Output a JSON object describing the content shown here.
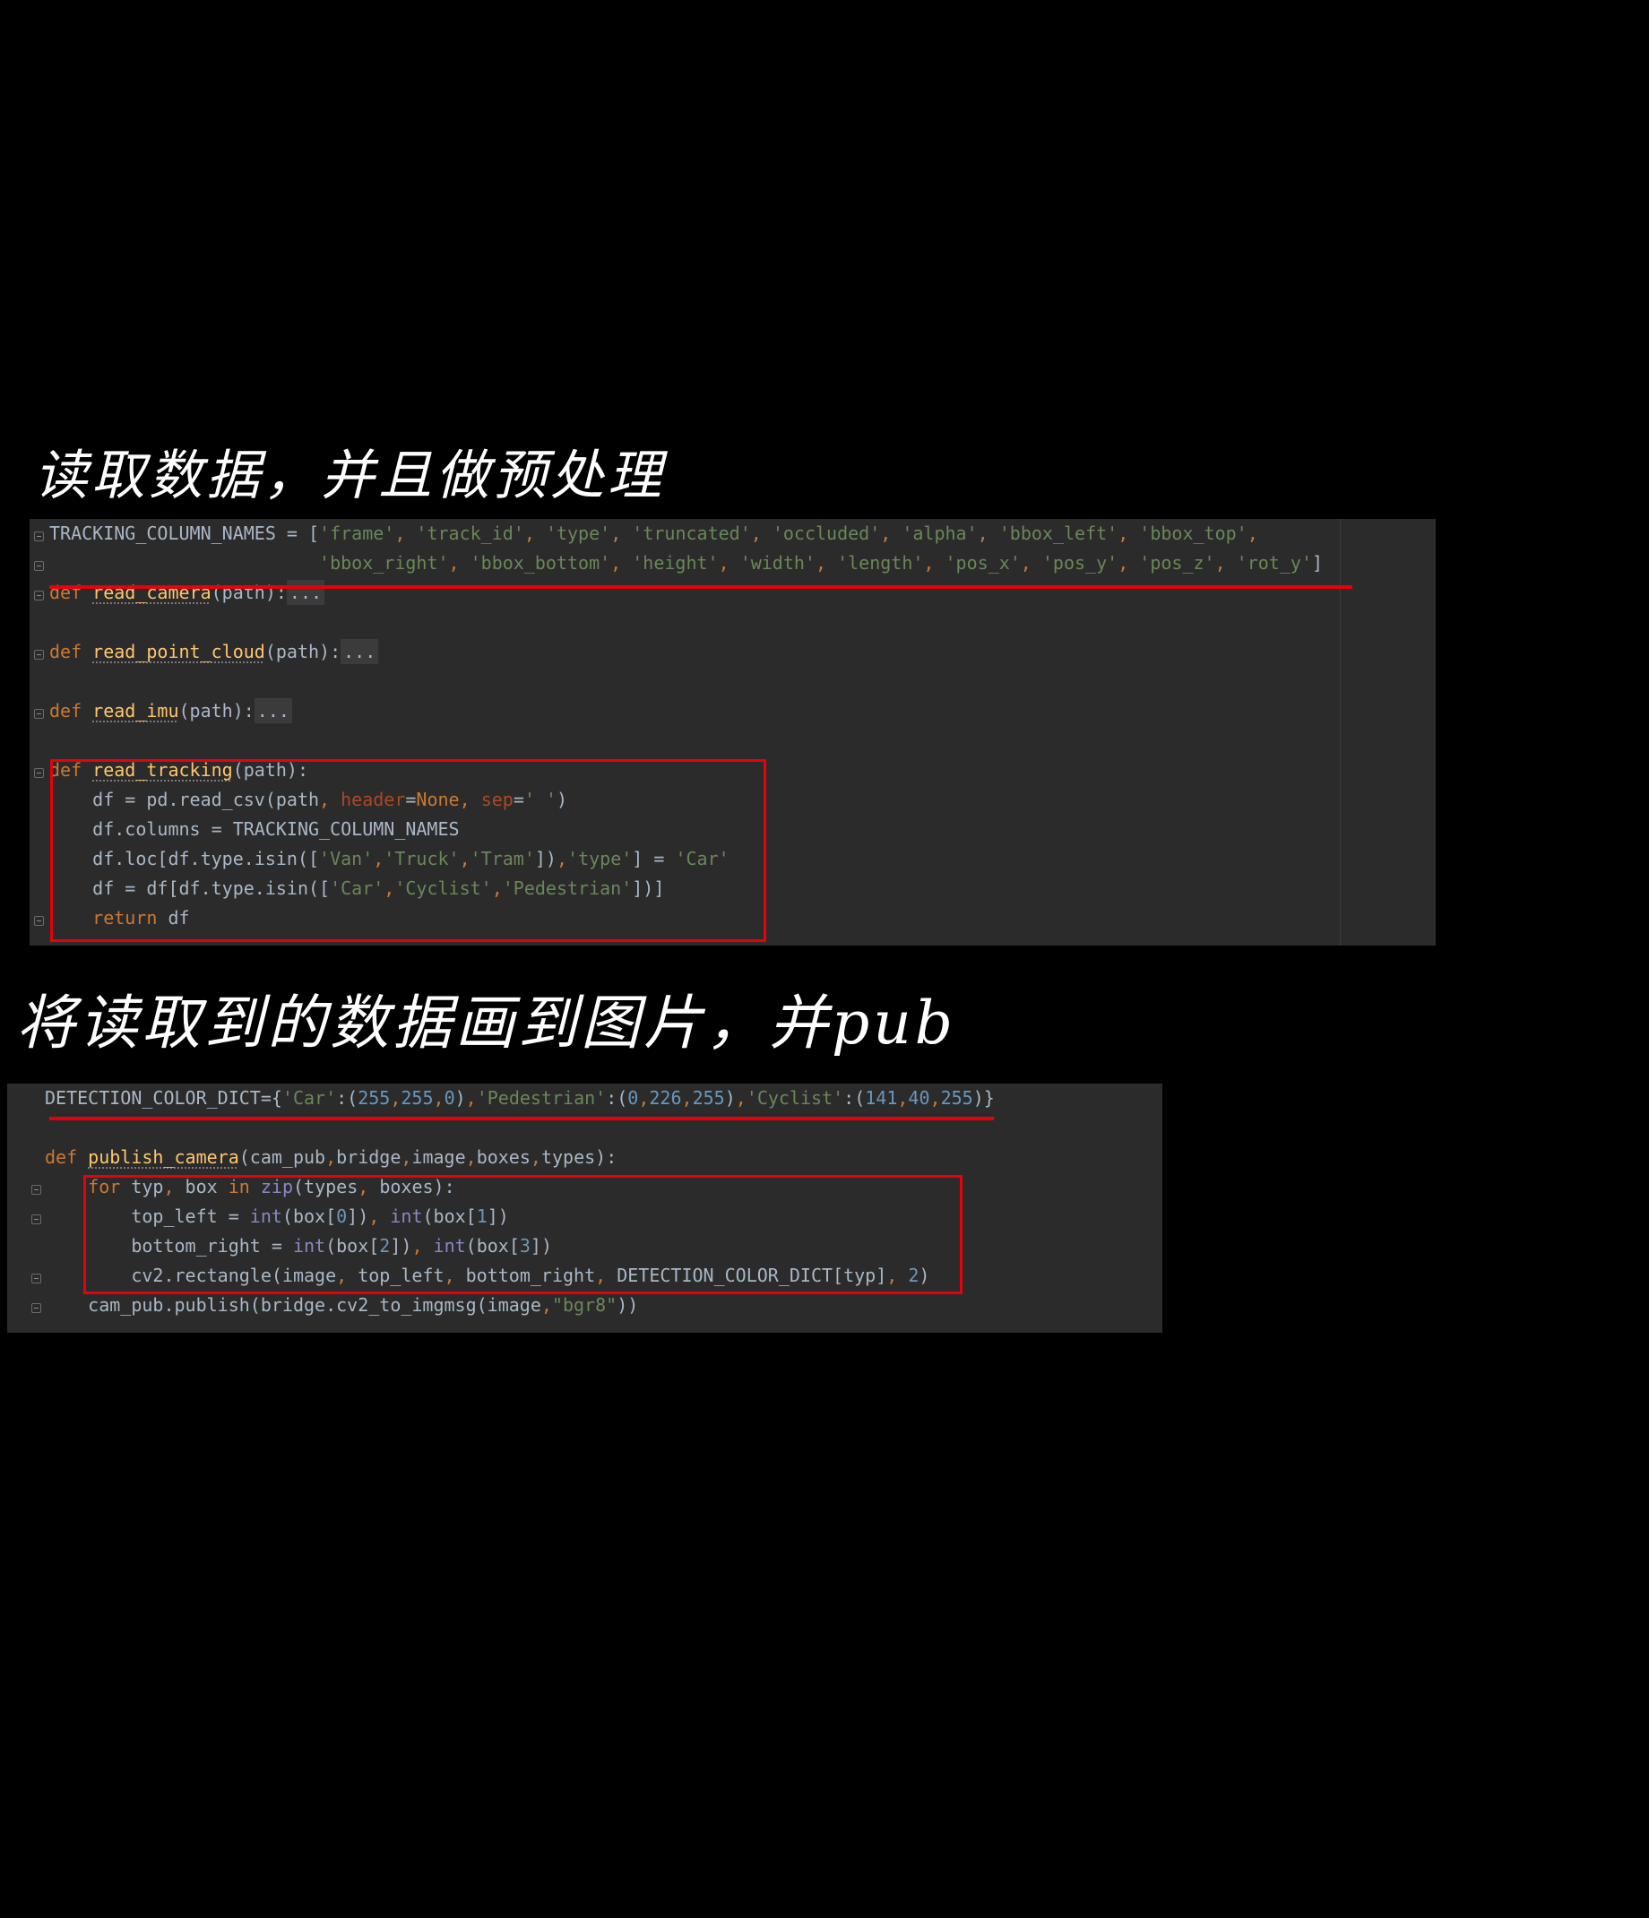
{
  "notes": {
    "section1": "读取数据，并且做预处理",
    "section2": "将读取到的数据画到图片，并pub"
  },
  "editor1": {
    "lines": [
      "TRACKING_COLUMN_NAMES = ['frame', 'track_id', 'type', 'truncated', 'occluded', 'alpha', 'bbox_left', 'bbox_top',",
      "                         'bbox_right', 'bbox_bottom', 'height', 'width', 'length', 'pos_x', 'pos_y', 'pos_z', 'rot_y']",
      "def read_camera(path):...",
      "",
      "def read_point_cloud(path):...",
      "",
      "def read_imu(path):...",
      "",
      "def read_tracking(path):",
      "    df = pd.read_csv(path, header=None, sep=' ')",
      "    df.columns = TRACKING_COLUMN_NAMES",
      "    df.loc[df.type.isin(['Van','Truck','Tram']),'type'] = 'Car'",
      "    df = df[df.type.isin(['Car','Cyclist','Pedestrian'])]",
      "    return df"
    ]
  },
  "editor2": {
    "lines": [
      "DETECTION_COLOR_DICT={'Car':(255,255,0),'Pedestrian':(0,226,255),'Cyclist':(141,40,255)}",
      "",
      "def publish_camera(cam_pub,bridge,image,boxes,types):",
      "    for typ, box in zip(types, boxes):",
      "        top_left = int(box[0]), int(box[1])",
      "        bottom_right = int(box[2]), int(box[3])",
      "        cv2.rectangle(image, top_left, bottom_right, DETECTION_COLOR_DICT[typ], 2)",
      "    cam_pub.publish(bridge.cv2_to_imgmsg(image,\"bgr8\"))"
    ]
  },
  "colors": {
    "background": "#000000",
    "editor_bg": "#2b2b2b",
    "annotation_red": "#e8000b",
    "keyword": "#cc7832",
    "function": "#ffc66d",
    "string": "#6a8759",
    "number": "#6897bb",
    "text": "#a9b7c6"
  }
}
